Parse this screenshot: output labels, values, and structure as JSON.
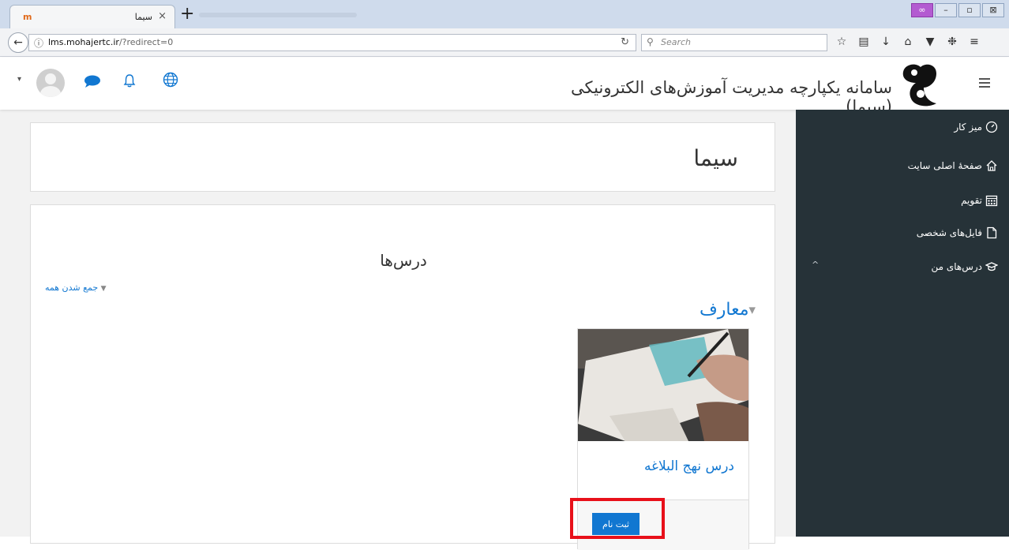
{
  "browser": {
    "tab_title": "سیما",
    "tab_favicon": "m",
    "tab_close": "×",
    "new_tab": "+",
    "window_buttons": [
      "∞",
      "–",
      "▫",
      "⊠"
    ],
    "url_host": "lms.mohajertc.ir",
    "url_path": "/?redirect=0",
    "search_placeholder": "Search",
    "toolbar_icons": [
      "star-icon",
      "reading-list-icon",
      "download-icon",
      "home-icon",
      "pocket-icon",
      "extension-icon",
      "menu-icon"
    ]
  },
  "header": {
    "site_title": "سامانه یکپارچه مدیریت آموزش‌های الکترونیکی (سیما)",
    "user_menu_caret": "▾"
  },
  "sidebar": {
    "items": [
      {
        "label": "میز کار",
        "icon": "dashboard-icon"
      },
      {
        "label": "صفحهٔ اصلی سایت",
        "icon": "home-icon"
      },
      {
        "label": "تقویم",
        "icon": "calendar-icon"
      },
      {
        "label": "فایل‌های شخصی",
        "icon": "file-icon"
      },
      {
        "label": "درس‌های من",
        "icon": "graduation-cap-icon"
      }
    ],
    "expander": "^"
  },
  "main": {
    "page_heading": "سیما",
    "courses_title": "درس‌ها",
    "collapse_all": "جمع شدن همه",
    "category": "معارف",
    "course": {
      "name": "درس نهج البلاغه",
      "enrol_button": "ثبت نام"
    }
  },
  "colors": {
    "accent": "#1177d1",
    "sidebar_bg": "#263238",
    "highlight": "#e8101a"
  }
}
